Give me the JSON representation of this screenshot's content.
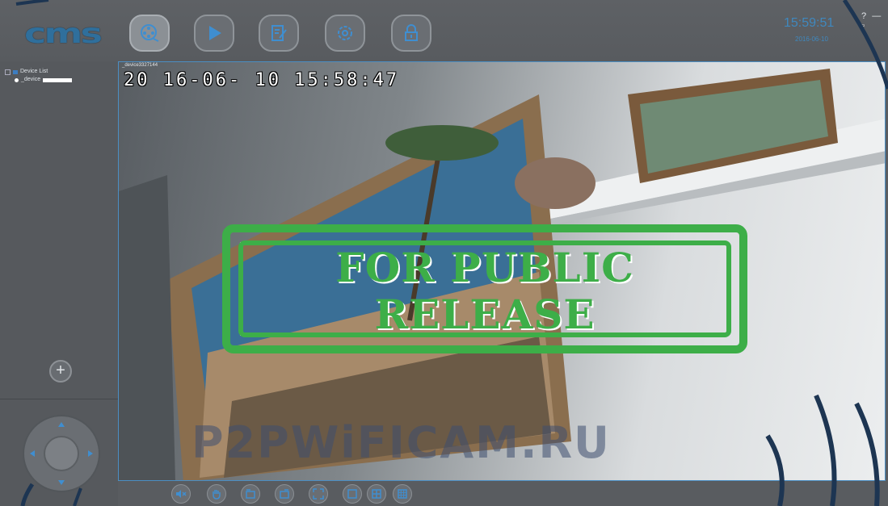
{
  "app": {
    "logo": "cms"
  },
  "nav": [
    {
      "name": "live-view",
      "icon": "film-reel-icon"
    },
    {
      "name": "playback",
      "icon": "play-icon"
    },
    {
      "name": "log",
      "icon": "edit-note-icon"
    },
    {
      "name": "settings",
      "icon": "gear-icon"
    },
    {
      "name": "lock",
      "icon": "lock-icon"
    }
  ],
  "header": {
    "time": "15:59:51",
    "date": "2016-06-10",
    "help": "?",
    "minimize": "—",
    "restore": "▫"
  },
  "tree": {
    "root": "Device List",
    "device": "_device"
  },
  "sidebar": {
    "add_label": "+"
  },
  "video": {
    "title": "_device3327144",
    "close": "x",
    "osd": "20 16-06- 10   15:58:47"
  },
  "overlay": {
    "stamp_line1": "FOR PUBLIC",
    "stamp_line2": "RELEASE",
    "watermark": "P2PWiFICAM.RU"
  },
  "colors": {
    "accent": "#3f8ed0",
    "stamp": "#3dae48",
    "background": "#5a5d61"
  },
  "bottombar": [
    {
      "name": "mute",
      "icon": "speaker-mute-icon"
    },
    {
      "name": "hand",
      "icon": "hand-icon"
    },
    {
      "name": "prev-group",
      "icon": "window-prev-icon"
    },
    {
      "name": "next-group",
      "icon": "window-next-icon"
    },
    {
      "name": "fullscreen",
      "icon": "fullscreen-icon"
    },
    {
      "name": "layout-1",
      "icon": "layout-1-icon"
    },
    {
      "name": "layout-4",
      "icon": "layout-4-icon"
    },
    {
      "name": "layout-9",
      "icon": "layout-9-icon"
    }
  ]
}
